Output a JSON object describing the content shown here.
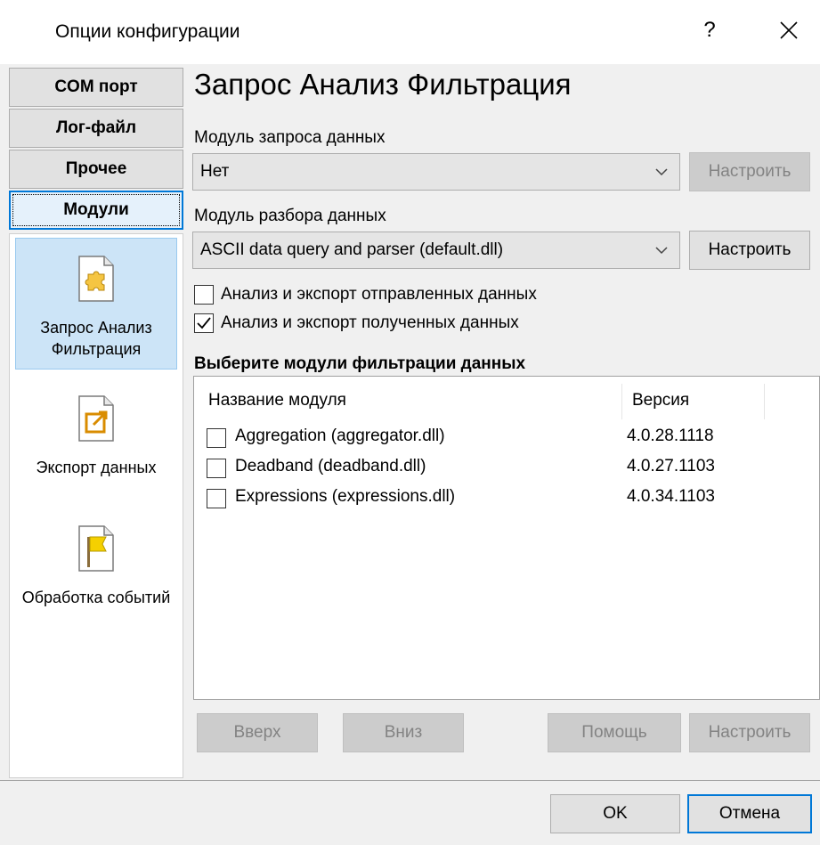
{
  "window": {
    "title": "Опции конфигурации",
    "help_label": "?",
    "close_icon": "close-icon"
  },
  "nav": {
    "buttons": [
      {
        "label": "COM порт"
      },
      {
        "label": "Лог-файл"
      },
      {
        "label": "Прочее"
      },
      {
        "label": "Модули"
      }
    ],
    "items": [
      {
        "label": "Запрос Анализ Фильтрация",
        "icon": "puzzle-document-icon"
      },
      {
        "label": "Экспорт данных",
        "icon": "export-document-icon"
      },
      {
        "label": "Обработка событий",
        "icon": "flag-icon"
      }
    ]
  },
  "main": {
    "heading": "Запрос Анализ Фильтрация",
    "query_module": {
      "label": "Модуль запроса данных",
      "value": "Нет",
      "configure_label": "Настроить"
    },
    "parser_module": {
      "label": "Модуль разбора данных",
      "value": "ASCII data query and parser (default.dll)",
      "configure_label": "Настроить"
    },
    "checkboxes": [
      {
        "label": "Анализ и экспорт отправленных данных",
        "checked": false
      },
      {
        "label": "Анализ и экспорт полученных данных",
        "checked": true
      }
    ],
    "filter_section_title": "Выберите модули фильтрации данных",
    "filter_table": {
      "columns": [
        "Название модуля",
        "Версия"
      ],
      "rows": [
        {
          "name": "Aggregation (aggregator.dll)",
          "version": "4.0.28.1118",
          "checked": false
        },
        {
          "name": "Deadband (deadband.dll)",
          "version": "4.0.27.1103",
          "checked": false
        },
        {
          "name": "Expressions (expressions.dll)",
          "version": "4.0.34.1103",
          "checked": false
        }
      ]
    },
    "list_buttons": {
      "up": "Вверх",
      "down": "Вниз",
      "help": "Помощь",
      "configure": "Настроить"
    }
  },
  "footer": {
    "ok": "OK",
    "cancel": "Отмена"
  },
  "colors": {
    "accent": "#0078d7",
    "selection": "#cce4f7",
    "disabled_text": "#838383"
  }
}
